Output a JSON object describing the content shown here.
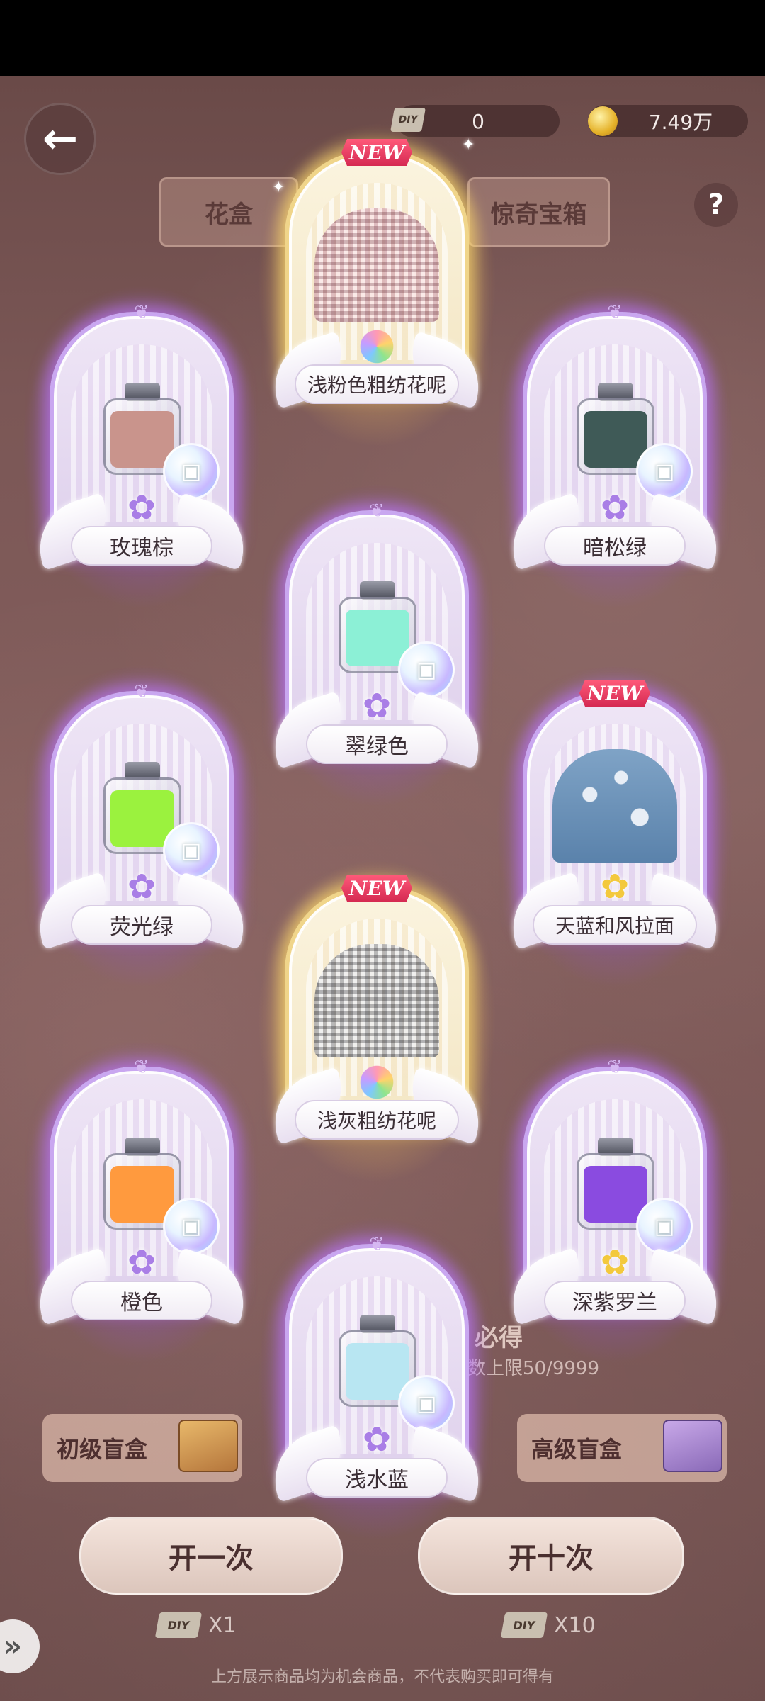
{
  "header": {
    "back_icon": "back-arrow-icon",
    "diy_badge": "DIY",
    "diy_amount": "0",
    "coin_amount": "7.49万",
    "help_symbol": "?"
  },
  "tabs": {
    "left": "花盒",
    "right": "惊奇宝箱"
  },
  "cards": [
    {
      "name": "浅粉色粗纺花呢",
      "new": "NEW"
    },
    {
      "name": "玫瑰棕"
    },
    {
      "name": "暗松绿"
    },
    {
      "name": "翠绿色"
    },
    {
      "name": "荧光绿"
    },
    {
      "name": "天蓝和风拉面",
      "new": "NEW"
    },
    {
      "name": "浅灰粗纺花呢",
      "new": "NEW"
    },
    {
      "name": "橙色"
    },
    {
      "name": "深紫罗兰"
    },
    {
      "name": "浅水蓝"
    }
  ],
  "colors": {
    "rose_brown": "#c9948c",
    "dark_pine_green": "#3f5a57",
    "emerald": "#8cf0d6",
    "fluorescent_green": "#9bf23e",
    "orange": "#ff9a3e",
    "deep_violet": "#8a4be0",
    "light_aqua": "#b8e6f2",
    "glow_purple": "#c9a7f0",
    "glow_gold": "#f0d58a"
  },
  "guarantee": {
    "title": "必得",
    "limit": "数上限50/9999"
  },
  "boxes": {
    "basic": "初级盲盒",
    "advanced": "高级盲盒"
  },
  "actions": {
    "open_once": "开一次",
    "open_ten": "开十次",
    "cost_once": "X1",
    "cost_ten": "X10",
    "cost_badge": "DIY"
  },
  "disclaimer": "上方展示商品均为机会商品，不代表购买即可得有",
  "skip_symbol": "»"
}
